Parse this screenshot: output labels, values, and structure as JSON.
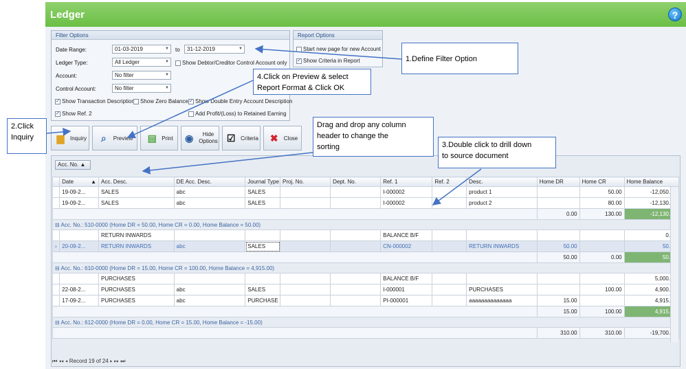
{
  "window": {
    "title": "Ledger"
  },
  "filter": {
    "title": "Filter Options",
    "date_range_label": "Date Range:",
    "date_from": "01-03-2019",
    "to_label": "to",
    "date_to": "31-12-2019",
    "ledger_type_label": "Ledger Type:",
    "ledger_type": "All Ledger",
    "show_debtor": "Show Debtor/Creditor Control Account only",
    "account_label": "Account:",
    "account": "No filter",
    "control_account_label": "Control Account:",
    "control_account": "No filter",
    "show_trans_desc": "Show Transaction Description",
    "show_zero_balance": "Show Zero Balance",
    "show_double_entry": "Show Double Entry Account Description",
    "show_ref2": "Show Ref. 2",
    "add_profit": "Add Profit/(Loss) to Retained Earning"
  },
  "report": {
    "title": "Report Options",
    "new_page": "Start new page for new Account",
    "show_criteria": "Show Criteria in Report"
  },
  "buttons": {
    "inquiry": "Inquiry",
    "preview": "Preview",
    "print": "Print",
    "hide_options_1": "Hide",
    "hide_options_2": "Options",
    "criteria": "Criteria",
    "close": "Close"
  },
  "callouts": {
    "c1": "1.Define Filter Option",
    "c2a": "2.Click",
    "c2b": "Inquiry",
    "c3a": "3.Double click to drill down",
    "c3b": "to source document",
    "c4a": "4.Click on Preview & select",
    "c4b": "Report Format  & Click OK",
    "drag_a": "Drag and drop any column",
    "drag_b": "header to change the",
    "drag_c": "sorting"
  },
  "group_box": "Acc. No.",
  "columns": [
    "Date",
    "Acc. Desc.",
    "DE Acc. Desc.",
    "Journal Type",
    "Proj. No.",
    "Dept. No.",
    "Ref. 1",
    "Ref. 2",
    "Desc.",
    "Home DR",
    "Home CR",
    "Home Balance"
  ],
  "rows": {
    "r1": [
      "19-09-2...",
      "SALES",
      "abc",
      "SALES",
      "",
      "",
      "I-000002",
      "",
      "product 1",
      "",
      "50.00",
      "-12,050.00"
    ],
    "r2": [
      "19-09-2...",
      "SALES",
      "abc",
      "SALES",
      "",
      "",
      "I-000002",
      "",
      "product 2",
      "",
      "80.00",
      "-12,130.00"
    ],
    "s1": [
      "0.00",
      "130.00",
      "-12,130.00"
    ],
    "g1": "Acc. No.: 510-0000 (Home DR = 50.00, Home CR = 0.00, Home Balance = 50.00)",
    "r3": [
      "",
      "RETURN INWARDS",
      "",
      "",
      "",
      "",
      "BALANCE B/F",
      "",
      "",
      "",
      "",
      "0.00"
    ],
    "r4": [
      "20-09-2...",
      "RETURN INWARDS",
      "abc",
      "SALES",
      "",
      "",
      "CN-000002",
      "",
      "RETURN INWARDS",
      "50.00",
      "",
      "50.00"
    ],
    "s2": [
      "50.00",
      "0.00",
      "50.00"
    ],
    "g2": "Acc. No.: 610-0000 (Home DR = 15.00, Home CR = 100.00, Home Balance = 4,915.00)",
    "r5": [
      "",
      "PURCHASES",
      "",
      "",
      "",
      "",
      "BALANCE B/F",
      "",
      "",
      "",
      "",
      "5,000.00"
    ],
    "r6": [
      "22-08-2...",
      "PURCHASES",
      "abc",
      "SALES",
      "",
      "",
      "I-000001",
      "",
      "PURCHASES",
      "",
      "100.00",
      "4,900.00"
    ],
    "r7": [
      "17-09-2...",
      "PURCHASES",
      "abc",
      "PURCHASE",
      "",
      "",
      "PI-000001",
      "",
      "aaaaaaaaaaaaaa",
      "15.00",
      "",
      "4,915.00"
    ],
    "s3": [
      "15.00",
      "100.00",
      "4,915.00"
    ],
    "g3": "Acc. No.: 612-0000 (Home DR = 0.00, Home CR = 15.00, Home Balance = -15.00)"
  },
  "totals": [
    "310.00",
    "310.00",
    "-19,700.00"
  ],
  "pager": {
    "record": "Record 19 of 24"
  }
}
